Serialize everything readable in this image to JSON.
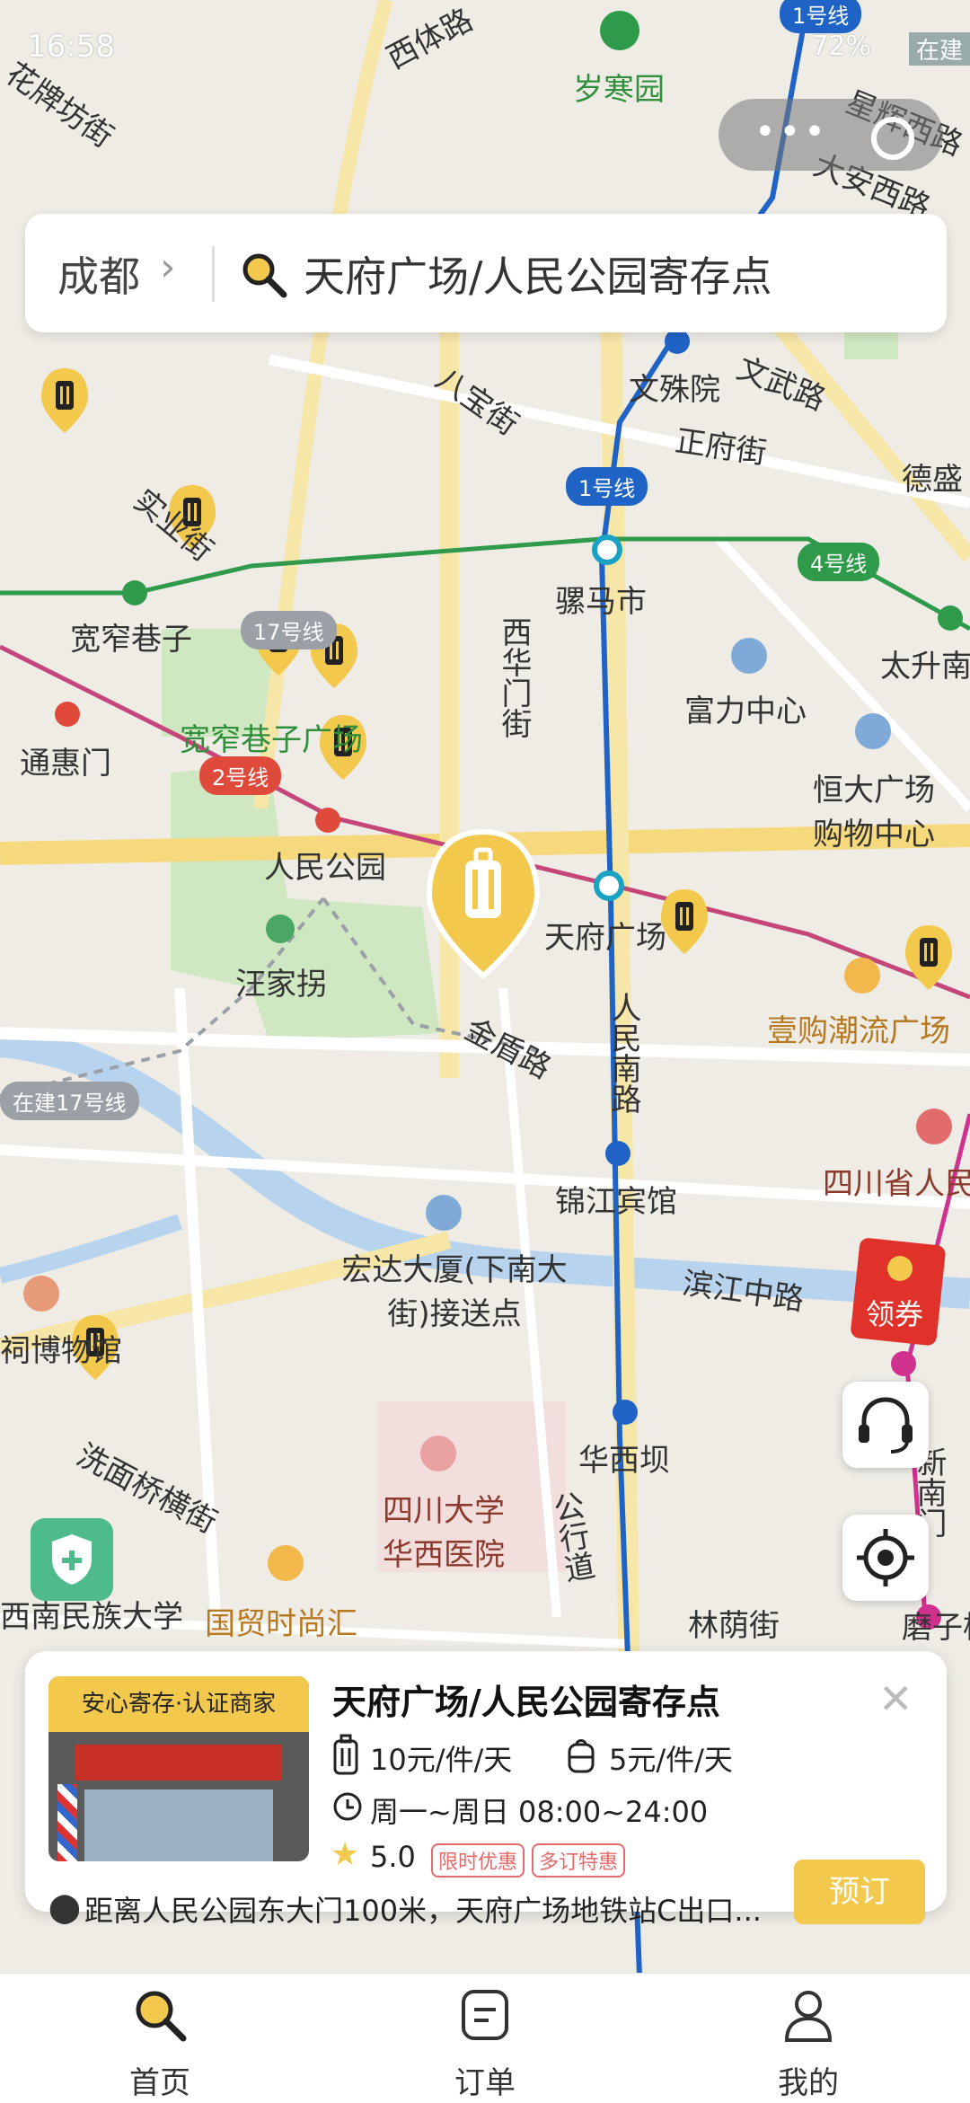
{
  "status_bar": {
    "time": "16:58",
    "battery": "72%",
    "in_build": "在建"
  },
  "search": {
    "city": "成都",
    "query": "天府广场/人民公园寄存点"
  },
  "map": {
    "labels": [
      "岁寒园",
      "西体路",
      "花牌坊街",
      "星辉西路",
      "大安西路",
      "文殊院",
      "文武路",
      "正府街",
      "德盛",
      "骡马市",
      "太升南",
      "宽窄巷子",
      "宽窄巷子广场",
      "通惠门",
      "富力中心",
      "恒大广场购物中心",
      "人民公园",
      "汪家拐",
      "天府广场",
      "壹购潮流广场",
      "金盾路",
      "人民南路",
      "锦江宾馆",
      "四川省人民",
      "宏达大厦(下南大街)接送点",
      "滨江中路",
      "华西坝",
      "四川大学华西医院",
      "洗面桥横街",
      "国贸时尚汇",
      "西南民族大学",
      "林荫街",
      "八宝街",
      "西华门街",
      "实业街",
      "公行道",
      "新南门",
      "磨子桥",
      "祠博物馆"
    ],
    "line_tags": {
      "line1_top": "1号线",
      "line1": "1号线",
      "line2": "2号线",
      "line4": "4号线",
      "line17a": "17号线",
      "line17b": "在建17号线"
    }
  },
  "coupon": {
    "label": "领券"
  },
  "store_card": {
    "badge": "安心寄存·认证商家",
    "title": "天府广场/人民公园寄存点",
    "price_large": "10元/件/天",
    "price_small": "5元/件/天",
    "hours": "周一~周日 08:00~24:00",
    "rating": "5.0",
    "tags": [
      "限时优惠",
      "多订特惠"
    ],
    "address": "距离人民公园东大门100米，天府广场地铁站C出口...",
    "book_label": "预订"
  },
  "tabbar": {
    "items": [
      {
        "label": "首页"
      },
      {
        "label": "订单"
      },
      {
        "label": "我的"
      }
    ]
  }
}
